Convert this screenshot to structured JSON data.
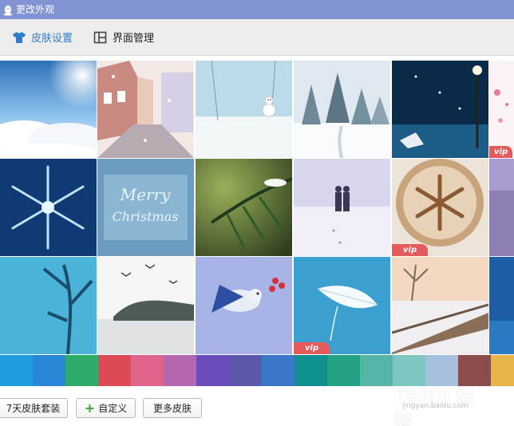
{
  "window": {
    "title": "更改外观"
  },
  "tabs": [
    {
      "label": "皮肤设置",
      "active": true,
      "icon": "tshirt-icon"
    },
    {
      "label": "界面管理",
      "active": false,
      "icon": "layout-icon"
    }
  ],
  "tiles": [
    {
      "name": "skin-sky-clouds",
      "vip": false
    },
    {
      "name": "skin-snowy-street",
      "vip": false
    },
    {
      "name": "skin-snowman",
      "vip": false
    },
    {
      "name": "skin-snow-forest",
      "vip": false
    },
    {
      "name": "skin-night-lamp-umbrella",
      "vip": false
    },
    {
      "name": "skin-pink-flowers",
      "vip": true,
      "vip_label": "vip"
    },
    {
      "name": "skin-snowflake-blue",
      "vip": false
    },
    {
      "name": "skin-merry-christmas",
      "vip": false
    },
    {
      "name": "skin-pine-branch",
      "vip": false
    },
    {
      "name": "skin-couple-snow-walk",
      "vip": false
    },
    {
      "name": "skin-latte-snowflake",
      "vip": true,
      "vip_label": "vip"
    },
    {
      "name": "skin-purple-partial",
      "vip": false
    },
    {
      "name": "skin-blue-branches",
      "vip": false
    },
    {
      "name": "skin-lake-birds",
      "vip": false
    },
    {
      "name": "skin-bird-berries",
      "vip": false
    },
    {
      "name": "skin-white-feather",
      "vip": true,
      "vip_label": "vip"
    },
    {
      "name": "skin-snow-bridge",
      "vip": false
    },
    {
      "name": "skin-blue-partial",
      "vip": false
    }
  ],
  "merry_text": {
    "line1": "Merry",
    "line2": "Christmas"
  },
  "colors": [
    "#1f9de0",
    "#2a86d8",
    "#2fab6a",
    "#dd4a55",
    "#e0648a",
    "#b467b0",
    "#6a4cba",
    "#5a58a8",
    "#3a77c8",
    "#10918f",
    "#25a283",
    "#55b5a7",
    "#7ec7c0",
    "#a5c1dd",
    "#8a4d4c",
    "#e9b44a"
  ],
  "buttons": {
    "skin_suite": "7天皮肤套装",
    "custom": "自定义",
    "more": "更多皮肤"
  },
  "watermark": {
    "brand": "Baidu 经验",
    "url": "jingyan.baidu.com"
  }
}
